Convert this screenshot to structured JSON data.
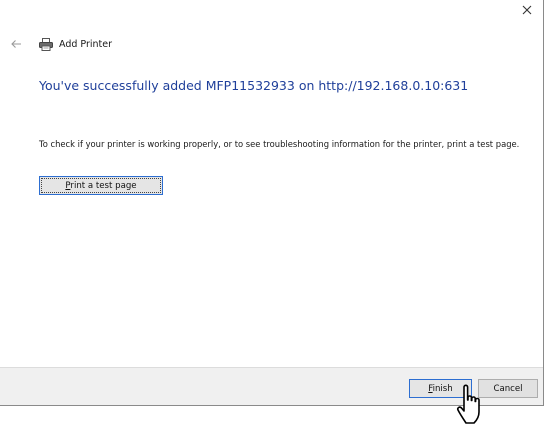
{
  "header": {
    "close_glyph": "✕",
    "back_icon": "back-arrow-icon",
    "printer_icon": "printer-icon",
    "title": "Add Printer"
  },
  "main": {
    "headline": "You've successfully added MFP11532933 on http://192.168.0.10:631",
    "instructions": "To check if your printer is working properly, or to see troubleshooting information for the printer, print a test page.",
    "test_button_label": "Print a test page"
  },
  "footer": {
    "finish_label": "Finish",
    "cancel_label": "Cancel"
  },
  "colors": {
    "headline": "#1f3f9a",
    "focus_border": "#2d6ed1",
    "footer_bg": "#f0f0f0"
  }
}
